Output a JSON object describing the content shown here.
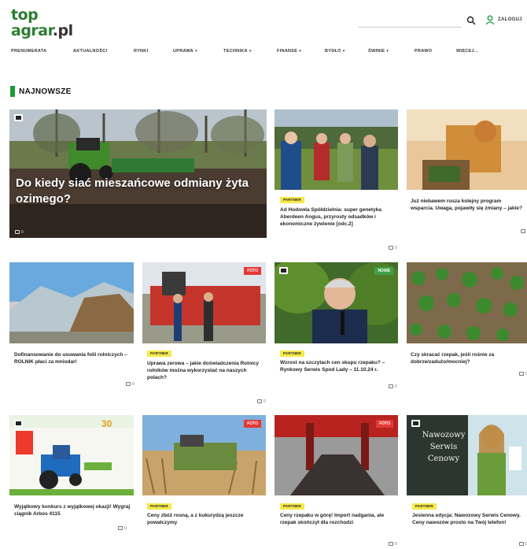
{
  "logo": {
    "line1": "top",
    "line2": "agrar",
    "suffix": ".pl"
  },
  "search": {
    "placeholder": ""
  },
  "header": {
    "login_label": "ZALOGUJ"
  },
  "nav": {
    "items": [
      {
        "label": "PRENUMERATA",
        "dropdown": false
      },
      {
        "label": "AKTUALNOŚCI",
        "dropdown": false
      },
      {
        "label": "RYNKI",
        "dropdown": false
      },
      {
        "label": "UPRAWA",
        "dropdown": true
      },
      {
        "label": "TECHNIKA",
        "dropdown": true
      },
      {
        "label": "FINANSE",
        "dropdown": true
      },
      {
        "label": "BYDŁO",
        "dropdown": true
      },
      {
        "label": "ŚWINIE",
        "dropdown": true
      },
      {
        "label": "PRAWO",
        "dropdown": false
      },
      {
        "label": "WIĘCEJ...",
        "dropdown": false
      }
    ]
  },
  "section": {
    "title": "NAJNOWSZE"
  },
  "hero": {
    "title": "Do kiedy siać mieszańcowe odmiany żyta ozimego?",
    "comments": "0"
  },
  "articles": [
    {
      "tag": "PARTNER",
      "title": "Ad Hodowla Spółdzielnia: super genetyka Aberdeen Angus, przyrosty odsadków i ekonomiczne żywienie [odc.2]",
      "comments": "0"
    },
    {
      "tag": "",
      "title": "Już niebawem rusza kolejny program wsparcia. Uwaga, pojawiły się zmiany – jakie?",
      "comments": "0"
    },
    {
      "tag": "",
      "title": "Dofinansowanie do usuwania folii rolniczych – ROLNIK płaci za mniodar!",
      "comments": "0"
    },
    {
      "tag": "PARTNER",
      "title": "Uprawa zerowa – jakie doświadczenia Rolnicy rolników można wykorzystać na naszych polach?",
      "comments": "0"
    },
    {
      "tag": "PARTNER",
      "title": "Wzrost na szczytach cen skupu rzepaku? – Rynkowy Serwis Spod Lady – 11.10.24 r.",
      "comments": "0"
    },
    {
      "tag": "",
      "title": "Czy skracać rzepak, jeśli rośnie za dobrze/zadużo/mocniej?",
      "comments": "0"
    },
    {
      "tag": "",
      "title": "Wyjątkowy konkurs z wyjątkowej okazji! Wygraj ciągnik Arbos 4115",
      "comments": "0"
    },
    {
      "tag": "PARTNER",
      "title": "Ceny zbóż rosną, a z kukurydzą jeszcze powalczymy",
      "comments": "0"
    },
    {
      "tag": "PARTNER",
      "title": "Ceny rzepaku w górę! Import nadgania, ale rzepak skończył dla rozchodzi",
      "comments": "0"
    },
    {
      "tag": "PARTNER",
      "title": "Jesienna edycja: Nawozowy Serwis Cenowy. Ceny nawozów prosto na Twój telefon!",
      "comments": "0"
    }
  ],
  "badges": {
    "video": "FOTO",
    "new": "NOWE",
    "video2": "FOTO",
    "video3": "FOTO"
  },
  "promo": {
    "line1": "Nawozowy",
    "line2": "Serwis",
    "line3": "Cenowy"
  },
  "contest": {
    "number": "30"
  },
  "colors": {
    "brand_green": "#1e9a3a",
    "tag_yellow": "#f6e84a",
    "badge_red": "#e53935"
  }
}
